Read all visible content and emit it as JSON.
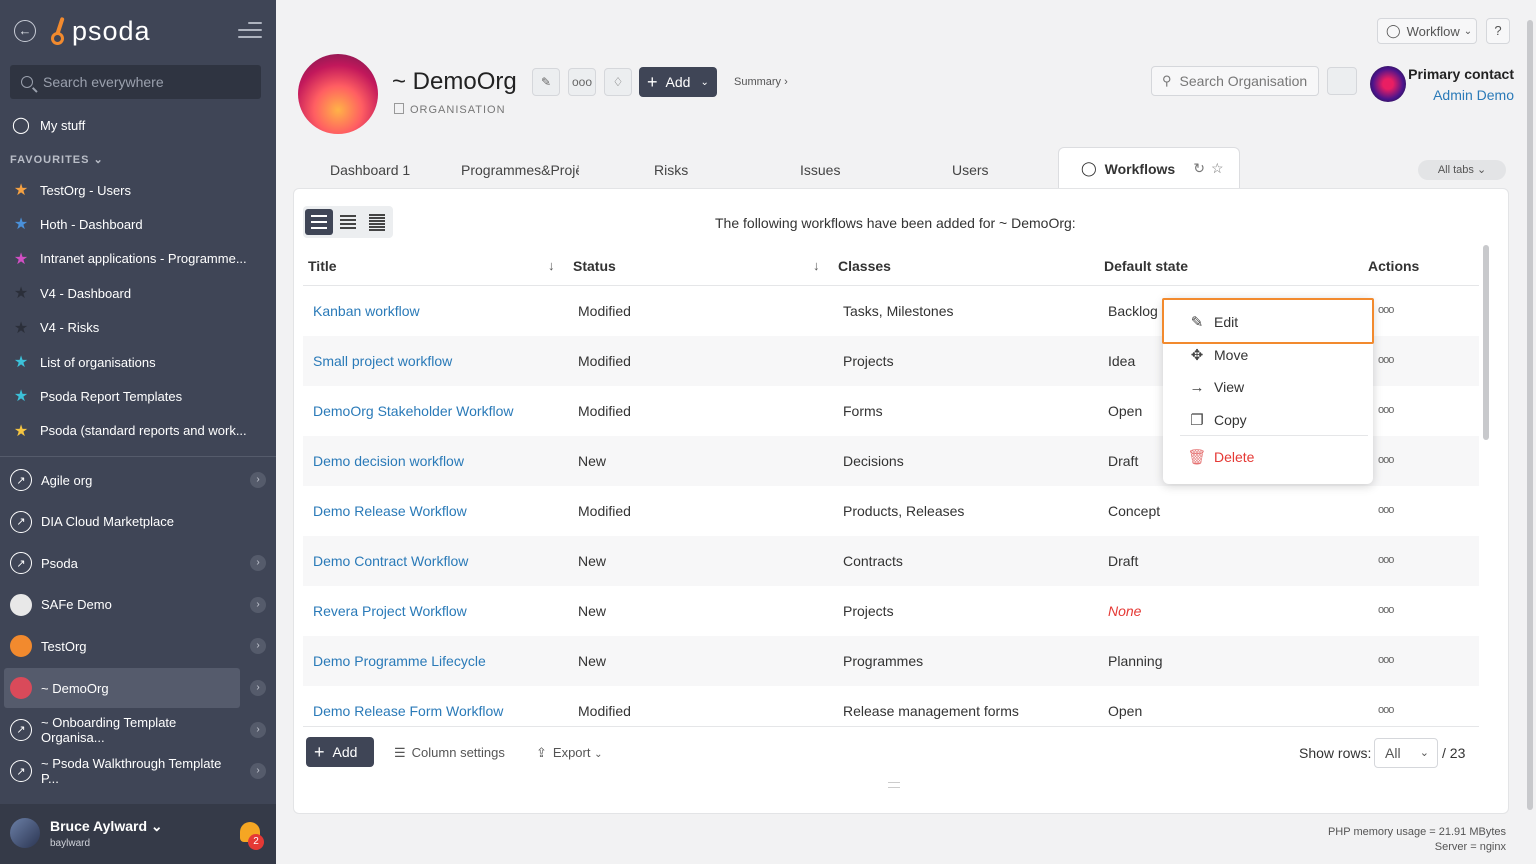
{
  "sidebar": {
    "logo": "psoda",
    "search_placeholder": "Search everywhere",
    "my_stuff": "My stuff",
    "favourites_header": "FAVOURITES",
    "favourites": [
      {
        "label": "TestOrg - Users",
        "color": "#f5a142"
      },
      {
        "label": "Hoth - Dashboard",
        "color": "#4a90d9"
      },
      {
        "label": "Intranet applications - Programme...",
        "color": "#d14fc4"
      },
      {
        "label": "V4 - Dashboard",
        "color": "#2b2f3a"
      },
      {
        "label": "V4 - Risks",
        "color": "#2b2f3a"
      },
      {
        "label": "List of organisations",
        "color": "#3cc1d9"
      },
      {
        "label": "Psoda Report Templates",
        "color": "#3cc1d9"
      },
      {
        "label": "Psoda (standard reports and work...",
        "color": "#f5c542"
      }
    ],
    "orgs": [
      {
        "label": "Agile org",
        "arrow": true
      },
      {
        "label": "DIA Cloud Marketplace",
        "arrow": false
      },
      {
        "label": "Psoda",
        "arrow": true
      },
      {
        "label": "SAFe Demo",
        "arrow": true
      },
      {
        "label": "TestOrg",
        "arrow": true
      },
      {
        "label": "~ DemoOrg",
        "arrow": true
      },
      {
        "label": "~ Onboarding Template Organisa...",
        "arrow": true
      },
      {
        "label": "~ Psoda Walkthrough Template P...",
        "arrow": true
      }
    ],
    "user": {
      "name": "Bruce Aylward",
      "handle": "baylward",
      "notifications": "2"
    }
  },
  "topbar": {
    "workflow_label": "Workflow",
    "help_label": "?"
  },
  "header": {
    "title": "~ DemoOrg",
    "subtitle": "ORGANISATION",
    "add_label": "Add",
    "summary_label": "Summary ›",
    "search_placeholder": "Search Organisation",
    "primary_contact_label": "Primary contact",
    "primary_contact_name": "Admin Demo"
  },
  "tabs": [
    "Dashboard 1",
    "Programmes&Projē",
    "Risks",
    "Issues",
    "Users"
  ],
  "active_tab": "Workflows",
  "all_tabs_label": "All tabs",
  "intro_text": "The following workflows have been added for ~ DemoOrg:",
  "table": {
    "columns": [
      "Title",
      "Status",
      "Classes",
      "Default state",
      "Actions"
    ],
    "rows": [
      {
        "title": "Kanban workflow",
        "status": "Modified",
        "classes": "Tasks, Milestones",
        "state": "Backlog",
        "none": false
      },
      {
        "title": "Small project workflow",
        "status": "Modified",
        "classes": "Projects",
        "state": "Idea",
        "none": false
      },
      {
        "title": "DemoOrg Stakeholder Workflow",
        "status": "Modified",
        "classes": "Forms",
        "state": "Open",
        "none": false
      },
      {
        "title": "Demo decision workflow",
        "status": "New",
        "classes": "Decisions",
        "state": "Draft",
        "none": false
      },
      {
        "title": "Demo Release Workflow",
        "status": "Modified",
        "classes": "Products, Releases",
        "state": "Concept",
        "none": false
      },
      {
        "title": "Demo Contract Workflow",
        "status": "New",
        "classes": "Contracts",
        "state": "Draft",
        "none": false
      },
      {
        "title": "Revera Project Workflow",
        "status": "New",
        "classes": "Projects",
        "state": "None",
        "none": true
      },
      {
        "title": "Demo Programme Lifecycle",
        "status": "New",
        "classes": "Programmes",
        "state": "Planning",
        "none": false
      },
      {
        "title": "Demo Release Form Workflow",
        "status": "Modified",
        "classes": "Release management forms",
        "state": "Open",
        "none": false
      }
    ],
    "actions_icon": "ooo"
  },
  "context_menu": {
    "items": [
      "Edit",
      "Move",
      "View",
      "Copy",
      "Delete"
    ]
  },
  "footer": {
    "add_label": "Add",
    "column_settings_label": "Column settings",
    "export_label": "Export",
    "show_rows_label": "Show rows:",
    "show_rows_value": "All",
    "total": "/ 23",
    "memory": "PHP memory usage = 21.91 MBytes",
    "server": "Server = nginx"
  }
}
